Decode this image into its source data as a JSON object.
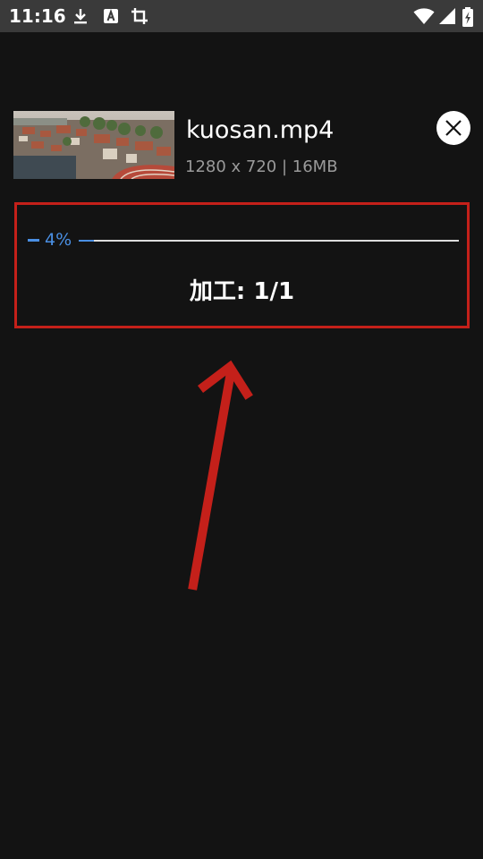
{
  "status_bar": {
    "time": "11:16",
    "icons": [
      "download-icon",
      "text-a-icon",
      "crop-icon",
      "wifi-icon",
      "signal-icon",
      "battery-charging-icon"
    ]
  },
  "file": {
    "name": "kuosan.mp4",
    "meta": "1280 x 720 | 16MB"
  },
  "progress": {
    "percent_label": "4%",
    "fraction": 0.04,
    "process_label": "加工: 1/1"
  },
  "colors": {
    "background": "#131313",
    "status_bar": "#3a3a3a",
    "accent_blue": "#4a8fe3",
    "annotation_red": "#c4201a"
  }
}
